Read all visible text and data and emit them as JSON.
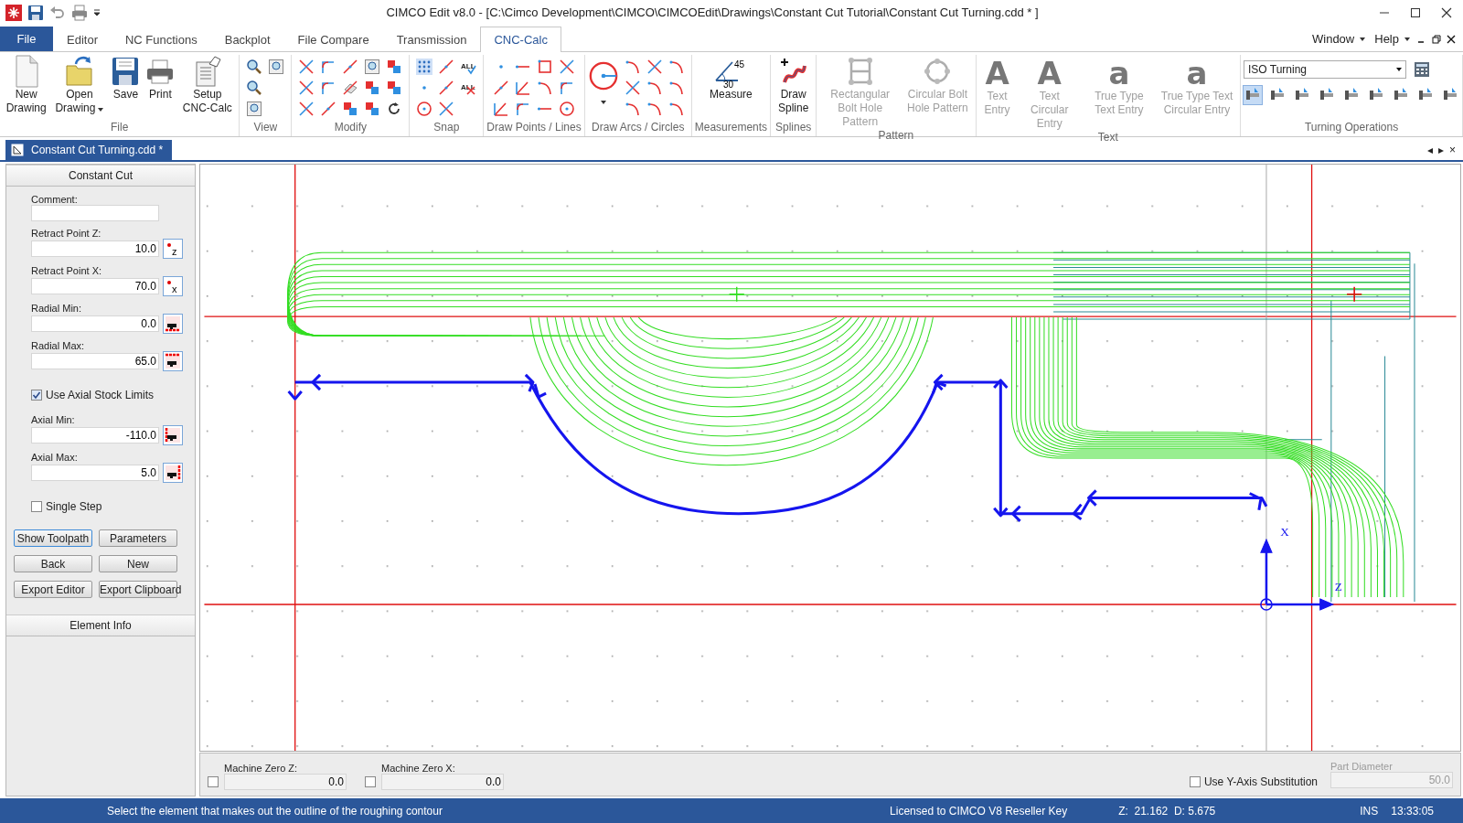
{
  "window": {
    "title": "CIMCO Edit v8.0 - [C:\\Cimco Development\\CIMCO\\CIMCOEdit\\Drawings\\Constant Cut Tutorial\\Constant Cut Turning.cdd * ]"
  },
  "menu_tabs": [
    {
      "label": "File",
      "kind": "file",
      "selected": false
    },
    {
      "label": "Editor",
      "kind": "tab",
      "selected": false
    },
    {
      "label": "NC Functions",
      "kind": "tab",
      "selected": false
    },
    {
      "label": "Backplot",
      "kind": "tab",
      "selected": false
    },
    {
      "label": "File Compare",
      "kind": "tab",
      "selected": false
    },
    {
      "label": "Transmission",
      "kind": "tab",
      "selected": false
    },
    {
      "label": "CNC-Calc",
      "kind": "tab",
      "selected": true
    }
  ],
  "menu_right": [
    "Window",
    "Help"
  ],
  "ribbon_groups": [
    {
      "kind": "file",
      "label": "File",
      "buttons": [
        {
          "label": "New Drawing",
          "dropdown": false
        },
        {
          "label": "Open Drawing",
          "dropdown": true
        },
        {
          "label": "Save",
          "dropdown": false
        },
        {
          "label": "Print",
          "dropdown": false
        },
        {
          "label": "Setup CNC-Calc",
          "dropdown": false
        }
      ]
    },
    {
      "kind": "view",
      "label": "View"
    },
    {
      "kind": "modify",
      "label": "Modify"
    },
    {
      "kind": "snap",
      "label": "Snap",
      "marks": [
        "ALL",
        "ALL"
      ]
    },
    {
      "kind": "points",
      "label": "Draw Points / Lines"
    },
    {
      "kind": "arcs",
      "label": "Draw Arcs / Circles"
    },
    {
      "kind": "measure",
      "label": "Measurements",
      "buttons": [
        {
          "label": "Measure"
        }
      ],
      "angles": [
        "45",
        "30"
      ]
    },
    {
      "kind": "splines",
      "label": "Splines",
      "buttons": [
        {
          "label": "Draw Spline"
        }
      ]
    },
    {
      "kind": "pattern",
      "label": "Pattern",
      "buttons": [
        {
          "label": "Rectangular Bolt Hole Pattern",
          "disabled": true
        },
        {
          "label": "Circular Bolt Hole Pattern",
          "disabled": true
        }
      ]
    },
    {
      "kind": "text",
      "label": "Text",
      "buttons": [
        {
          "label": "Text Entry",
          "glyph": "A",
          "disabled": true
        },
        {
          "label": "Text Circular Entry",
          "glyph": "A",
          "disabled": true
        },
        {
          "label": "True Type Text Entry",
          "glyph": "a",
          "disabled": true
        },
        {
          "label": "True Type Text Circular Entry",
          "glyph": "a",
          "disabled": true
        }
      ]
    },
    {
      "kind": "turning",
      "label": "Turning Operations",
      "select": "ISO Turning",
      "operations": [
        {
          "selected": true
        },
        {
          "selected": false
        },
        {
          "selected": false
        },
        {
          "selected": false
        },
        {
          "selected": false
        },
        {
          "selected": false
        },
        {
          "selected": false
        },
        {
          "selected": false
        },
        {
          "selected": false
        }
      ]
    }
  ],
  "document_tab": {
    "label": "Constant Cut Turning.cdd *",
    "selected": true
  },
  "document_nav": [
    "◂",
    "▸",
    "×"
  ],
  "panel": {
    "title": "Constant Cut",
    "fields": [
      {
        "kind": "text",
        "label": "Comment:"
      },
      {
        "kind": "point",
        "label": "Retract Point Z:",
        "value": "10.0",
        "axis": "z"
      },
      {
        "kind": "point",
        "label": "Retract Point X:",
        "value": "70.0",
        "axis": "x"
      },
      {
        "kind": "limit",
        "label": "Radial Min:",
        "value": "0.0"
      },
      {
        "kind": "limit",
        "label": "Radial Max:",
        "value": "65.0"
      },
      {
        "kind": "checkbox",
        "label": "Use Axial Stock Limits",
        "checked": true
      },
      {
        "kind": "limit",
        "label": "Axial Min:",
        "value": "-110.0"
      },
      {
        "kind": "limit",
        "label": "Axial Max:",
        "value": "5.0"
      },
      {
        "kind": "checkbox",
        "label": "Single Step",
        "checked": false
      }
    ],
    "buttons": [
      {
        "label": "Show Toolpath",
        "focused": true
      },
      {
        "label": "Parameters",
        "focused": false
      },
      {
        "label": "Back",
        "focused": false
      },
      {
        "label": "New",
        "focused": false
      },
      {
        "label": "Export Editor",
        "focused": false
      },
      {
        "label": "Export Clipboard",
        "focused": false
      }
    ],
    "footer": "Element Info"
  },
  "canvas": {
    "axis_labels": [
      "X",
      "Z"
    ]
  },
  "bottom_bar": {
    "machine_zero": [
      {
        "label": "Machine Zero Z:",
        "value": "0.0",
        "checked": false
      },
      {
        "label": "Machine Zero X:",
        "value": "0.0",
        "checked": false
      }
    ],
    "y_axis": {
      "label": "Use Y-Axis Substitution",
      "checked": false
    },
    "part_diameter": {
      "label": "Part Diameter",
      "value": "50.0",
      "disabled": true
    }
  },
  "status_bar": {
    "message": "Select the element that makes out the outline of the roughing contour",
    "license": "Licensed to CIMCO V8 Reseller Key",
    "coordinates": "Z:  21.162  D: 5.675",
    "mode": "INS",
    "time": "13:33:05"
  }
}
